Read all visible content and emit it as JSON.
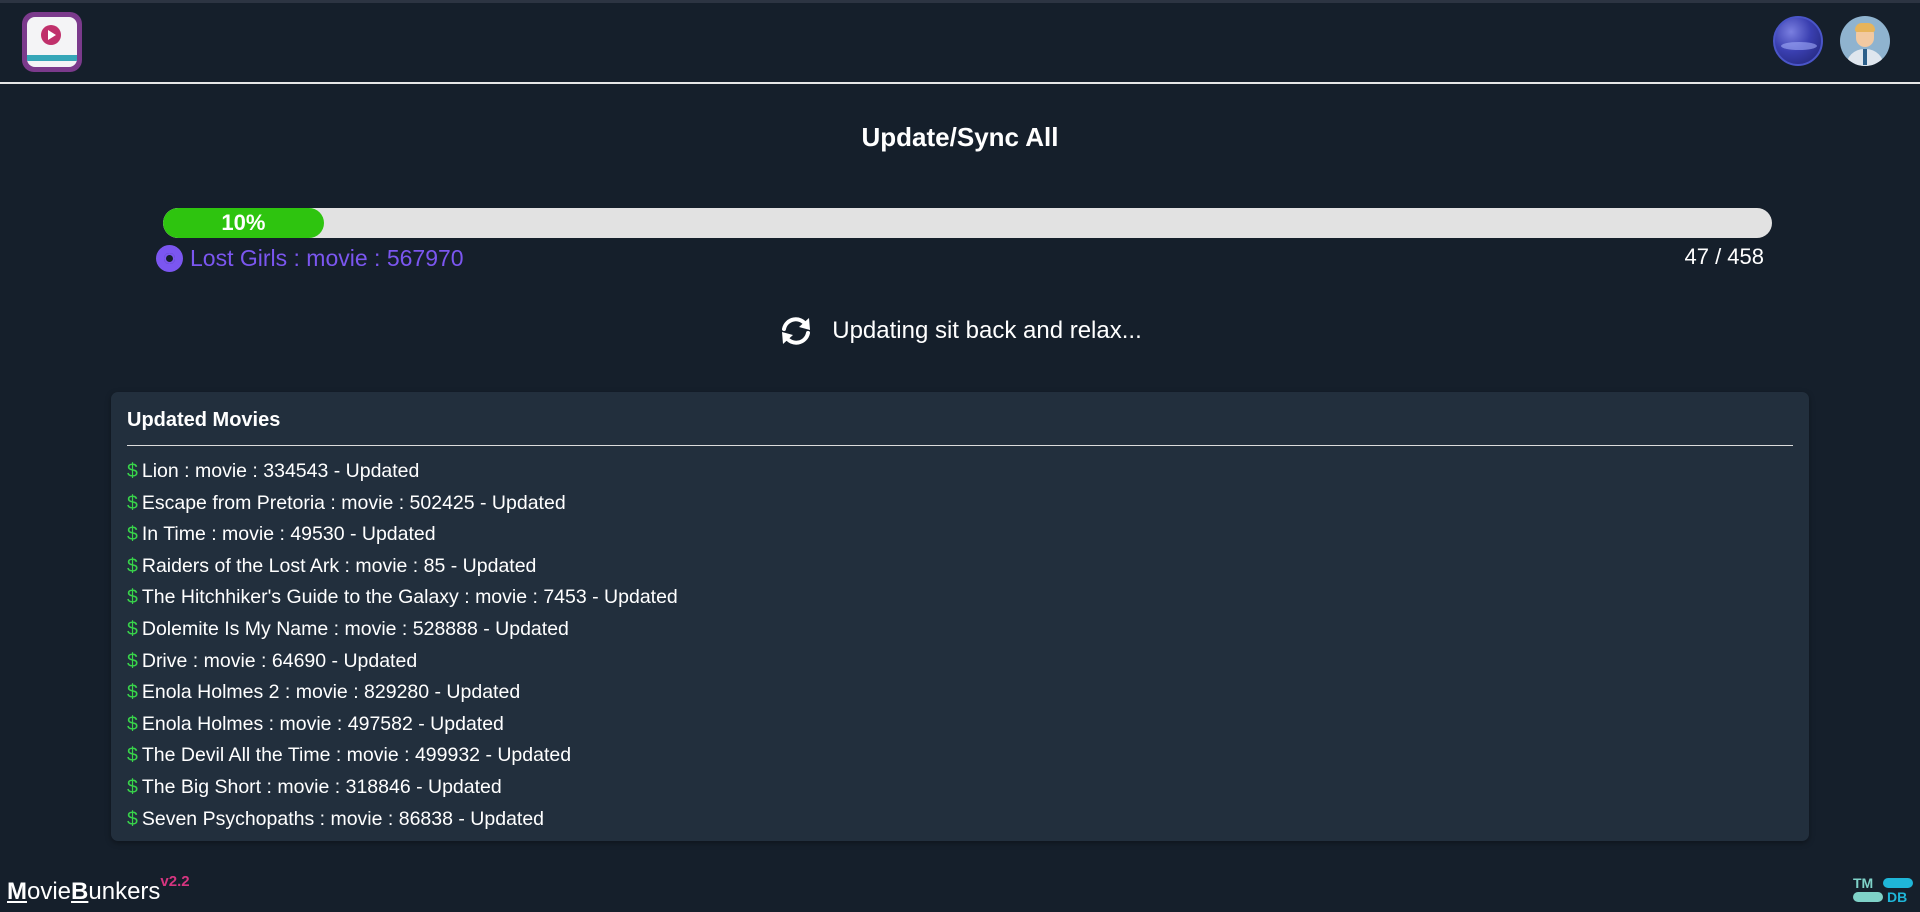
{
  "app": {
    "brand_first_letter": "M",
    "brand_middle": "ovie",
    "brand_second_letter": "B",
    "brand_rest": "unkers",
    "version": "v2.2"
  },
  "header": {
    "logo_icon": "play-video-icon",
    "globe_icon": "globe-icon",
    "avatar_icon": "user-avatar-icon"
  },
  "page": {
    "title": "Update/Sync All"
  },
  "progress": {
    "percent": 10,
    "label": "10%",
    "current_item": "Lost Girls : movie : 567970",
    "count_text": "47 / 458"
  },
  "status": {
    "icon": "sync-icon",
    "text": "Updating sit back and relax..."
  },
  "updated": {
    "heading": "Updated Movies",
    "bullet": "$",
    "items": [
      "Lion : movie : 334543 - Updated",
      "Escape from Pretoria : movie : 502425 - Updated",
      "In Time : movie : 49530 - Updated",
      "Raiders of the Lost Ark : movie : 85 - Updated",
      "The Hitchhiker's Guide to the Galaxy : movie : 7453 - Updated",
      "Dolemite Is My Name : movie : 528888 - Updated",
      "Drive : movie : 64690 - Updated",
      "Enola Holmes 2 : movie : 829280 - Updated",
      "Enola Holmes : movie : 497582 - Updated",
      "The Devil All the Time : movie : 499932 - Updated",
      "The Big Short : movie : 318846 - Updated",
      "Seven Psychopaths : movie : 86838 - Updated"
    ]
  },
  "footer": {
    "tmdb_top": "TM",
    "tmdb_bottom": "DB"
  },
  "colors": {
    "background": "#151f2b",
    "panel": "#222f3d",
    "progress_fill": "#2ec40f",
    "accent_purple": "#7b56f0",
    "bullet_green": "#38d44a",
    "version_pink": "#d63580"
  }
}
